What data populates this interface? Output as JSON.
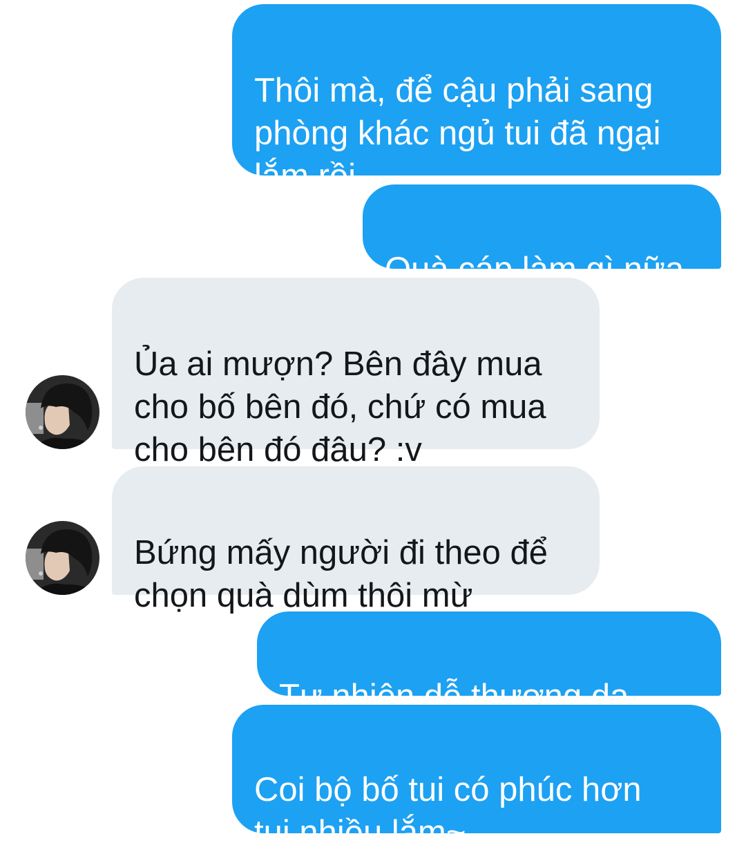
{
  "messages": [
    {
      "side": "outgoing",
      "text": "Thôi mà, để cậu phải sang\nphòng khác ngủ tui đã ngại\nlắm rồi"
    },
    {
      "side": "outgoing",
      "text": "Quà cáp làm gì nữa"
    },
    {
      "side": "incoming",
      "text": "Ủa ai mượn? Bên đây mua\ncho bố bên đó, chứ có mua\ncho bên đó đâu? :v"
    },
    {
      "side": "incoming",
      "text": "Bứng mấy người đi theo để\nchọn quà dùm thôi mừ"
    },
    {
      "side": "outgoing",
      "text": "Tự nhiên dễ thương dạ",
      "emoji": "eyes-icon"
    },
    {
      "side": "outgoing",
      "text": "Coi bộ bố tui có phúc hơn\ntui nhiều lắm~"
    }
  ],
  "colors": {
    "outgoing_bubble": "#1da1f2",
    "incoming_bubble": "#e6ecf0",
    "outgoing_text": "#ffffff",
    "incoming_text": "#14171a"
  }
}
